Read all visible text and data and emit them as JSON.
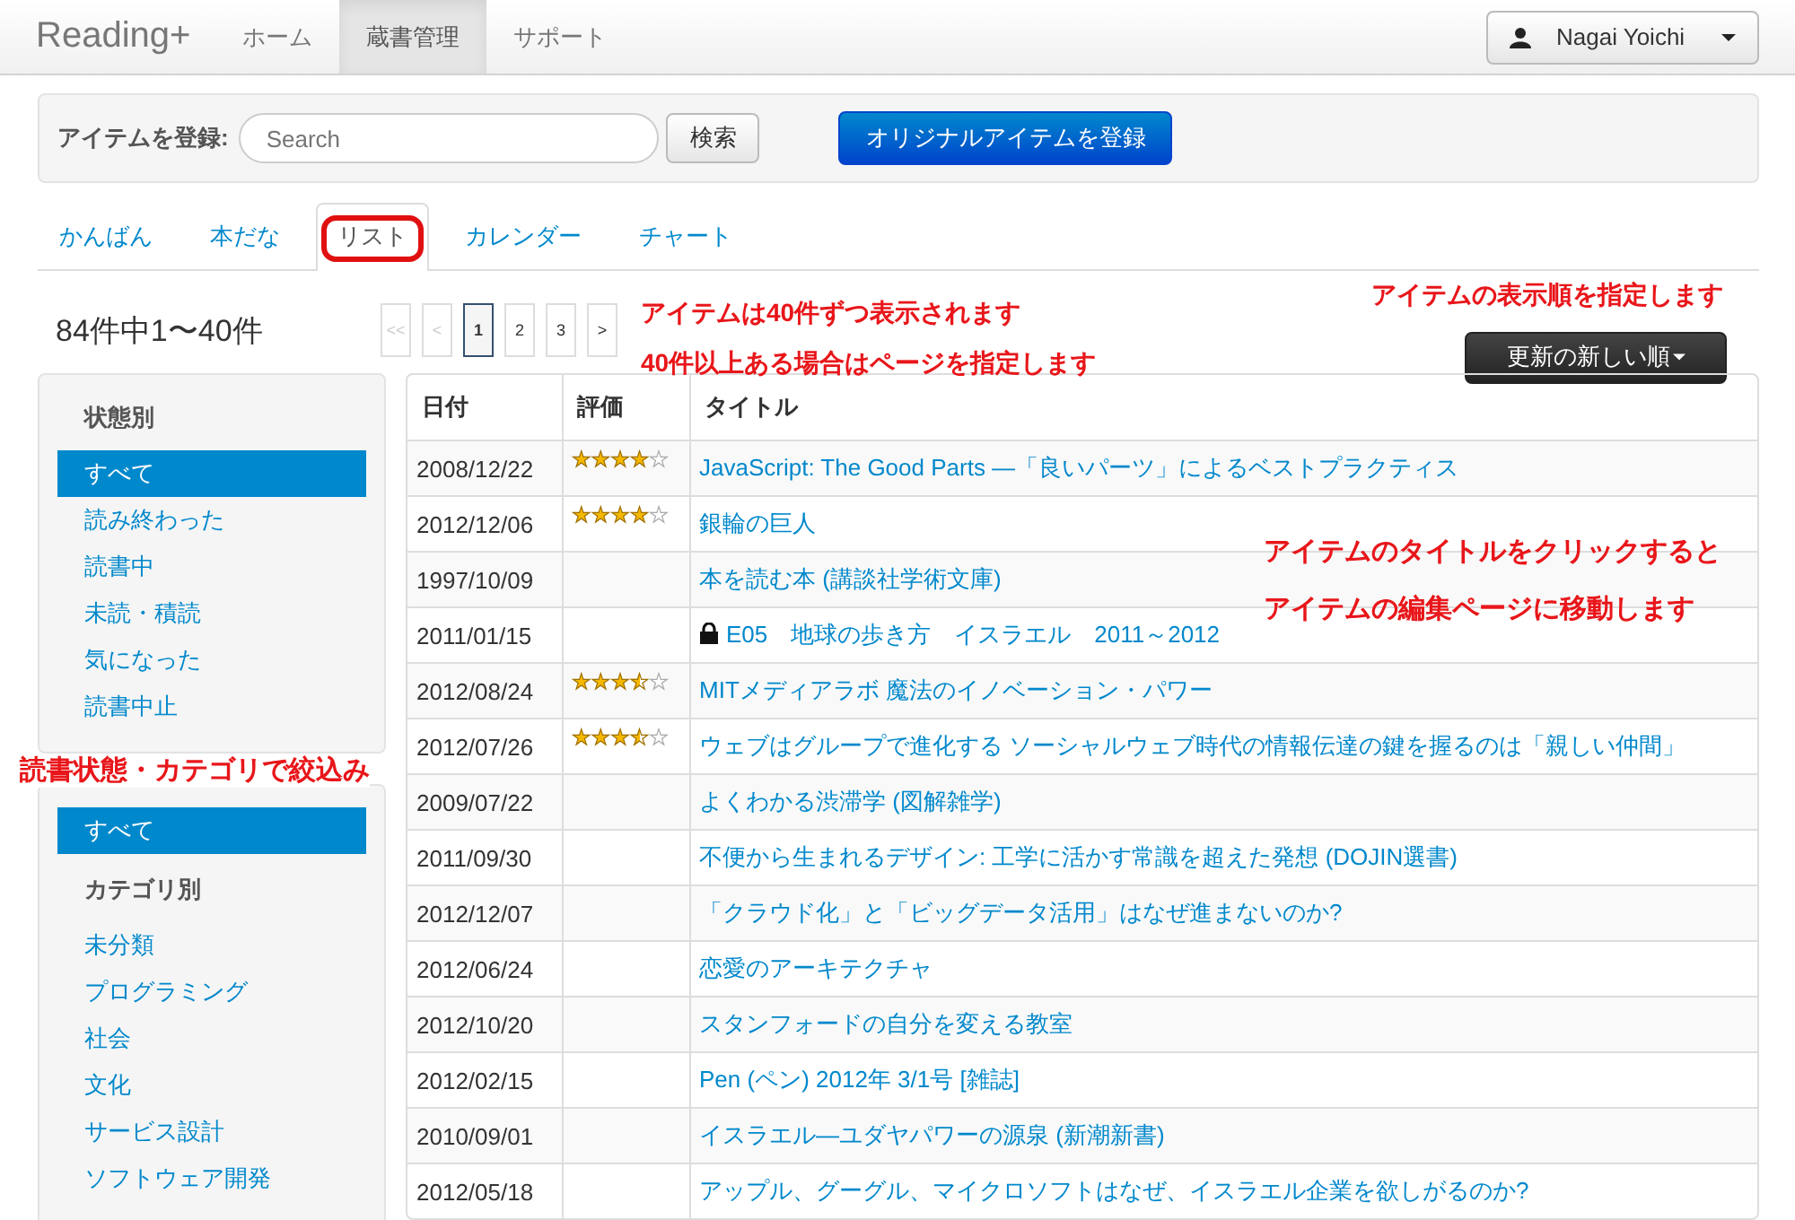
{
  "navbar": {
    "brand": "Reading+",
    "links": [
      {
        "label": "ホーム",
        "selected": false
      },
      {
        "label": "蔵書管理",
        "selected": true
      },
      {
        "label": "サポート",
        "selected": false
      }
    ],
    "user": "Nagai Yoichi"
  },
  "register": {
    "label": "アイテムを登録:",
    "placeholder": "Search",
    "search_button": "検索",
    "original_button": "オリジナルアイテムを登録"
  },
  "tabs": [
    {
      "label": "かんばん",
      "selected": false,
      "circled": false
    },
    {
      "label": "本だな",
      "selected": false,
      "circled": false
    },
    {
      "label": "リスト",
      "selected": true,
      "circled": true
    },
    {
      "label": "カレンダー",
      "selected": false,
      "circled": false
    },
    {
      "label": "チャート",
      "selected": false,
      "circled": false
    }
  ],
  "count": "84件中1〜40件",
  "pagination": [
    {
      "label": "<<",
      "selected": false,
      "disabled": true
    },
    {
      "label": "<",
      "selected": false,
      "disabled": true
    },
    {
      "label": "1",
      "selected": true,
      "disabled": false
    },
    {
      "label": "2",
      "selected": false,
      "disabled": false
    },
    {
      "label": "3",
      "selected": false,
      "disabled": false
    },
    {
      "label": ">",
      "selected": false,
      "disabled": false
    }
  ],
  "sort_button": "更新の新しい順",
  "sidebar": [
    {
      "heading": "状態別",
      "items": [
        {
          "label": "すべて",
          "selected": true
        },
        {
          "label": "読み終わった",
          "selected": false
        },
        {
          "label": "読書中",
          "selected": false
        },
        {
          "label": "未読・積読",
          "selected": false
        },
        {
          "label": "気になった",
          "selected": false
        },
        {
          "label": "読書中止",
          "selected": false
        }
      ]
    },
    {
      "top_items": [
        {
          "label": "すべて",
          "selected": true
        }
      ],
      "heading": "カテゴリ別",
      "items": [
        {
          "label": "未分類",
          "selected": false
        },
        {
          "label": "プログラミング",
          "selected": false
        },
        {
          "label": "社会",
          "selected": false
        },
        {
          "label": "文化",
          "selected": false
        },
        {
          "label": "サービス設計",
          "selected": false
        },
        {
          "label": "ソフトウェア開発",
          "selected": false
        }
      ]
    }
  ],
  "table": {
    "columns": [
      "日付",
      "評価",
      "タイトル"
    ],
    "rows": [
      {
        "date": "2008/12/22",
        "stars": 4,
        "title": "JavaScript: The Good Parts ―「良いパーツ」によるベストプラクティス",
        "locked": false
      },
      {
        "date": "2012/12/06",
        "stars": 4,
        "title": "銀輪の巨人",
        "locked": false
      },
      {
        "date": "1997/10/09",
        "title": "本を読む本 (講談社学術文庫)",
        "locked": false
      },
      {
        "date": "2011/01/15",
        "title": "E05　地球の歩き方　イスラエル　2011～2012",
        "locked": true
      },
      {
        "date": "2012/08/24",
        "stars": 3.5,
        "title": "MITメディアラボ 魔法のイノベーション・パワー",
        "locked": false
      },
      {
        "date": "2012/07/26",
        "stars": 3.5,
        "title": "ウェブはグループで進化する ソーシャルウェブ時代の情報伝達の鍵を握るのは「親しい仲間」",
        "locked": false
      },
      {
        "date": "2009/07/22",
        "title": "よくわかる渋滞学 (図解雑学)",
        "locked": false
      },
      {
        "date": "2011/09/30",
        "title": "不便から生まれるデザイン: 工学に活かす常識を超えた発想 (DOJIN選書)",
        "locked": false
      },
      {
        "date": "2012/12/07",
        "title": "「クラウド化」と「ビッグデータ活用」はなぜ進まないのか?",
        "locked": false
      },
      {
        "date": "2012/06/24",
        "title": "恋愛のアーキテクチャ",
        "locked": false
      },
      {
        "date": "2012/10/20",
        "title": "スタンフォードの自分を変える教室",
        "locked": false
      },
      {
        "date": "2012/02/15",
        "title": "Pen (ペン) 2012年 3/1号 [雑誌]",
        "locked": false
      },
      {
        "date": "2010/09/01",
        "title": "イスラエル―ユダヤパワーの源泉 (新潮新書)",
        "locked": false
      },
      {
        "date": "2012/05/18",
        "title": "アップル、グーグル、マイクロソフトはなぜ、イスラエル企業を欲しがるのか?",
        "locked": false
      }
    ]
  },
  "annotations": [
    {
      "kind": "paging",
      "lines": [
        "アイテムは40件ずつ表示されます",
        "40件以上ある場合はページを指定します"
      ]
    },
    {
      "kind": "sort",
      "lines": [
        "アイテムの表示順を指定します"
      ]
    },
    {
      "kind": "filter",
      "lines": [
        "読書状態・カテゴリで絞込み"
      ]
    },
    {
      "kind": "title",
      "lines": [
        "アイテムのタイトルをクリックすると",
        "アイテムの編集ページに移動します"
      ]
    }
  ]
}
